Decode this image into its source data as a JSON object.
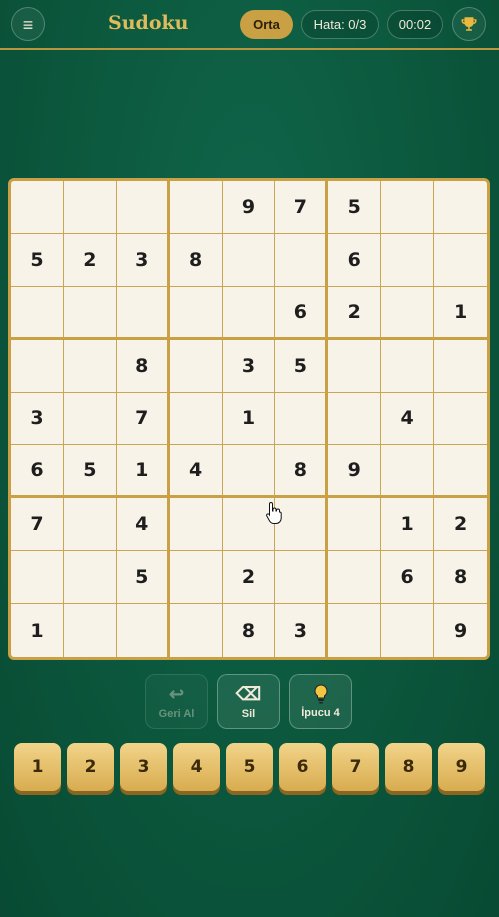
{
  "header": {
    "menu_icon": "≡",
    "title": "Sudoku",
    "difficulty": "Orta",
    "errors": "Hata: 0/3",
    "timer": "00:02",
    "trophy_icon": "trophy-icon"
  },
  "board": {
    "rows": [
      [
        "",
        "",
        "",
        "",
        "9",
        "7",
        "5",
        "",
        ""
      ],
      [
        "5",
        "2",
        "3",
        "8",
        "",
        "",
        "6",
        "",
        ""
      ],
      [
        "",
        "",
        "",
        "",
        "",
        "6",
        "2",
        "",
        "1"
      ],
      [
        "",
        "",
        "8",
        "",
        "3",
        "5",
        "",
        "",
        ""
      ],
      [
        "3",
        "",
        "7",
        "",
        "1",
        "",
        "",
        "4",
        ""
      ],
      [
        "6",
        "5",
        "1",
        "4",
        "",
        "8",
        "9",
        "",
        ""
      ],
      [
        "7",
        "",
        "4",
        "",
        "",
        "",
        "",
        "1",
        "2"
      ],
      [
        "",
        "",
        "5",
        "",
        "2",
        "",
        "",
        "6",
        "8"
      ],
      [
        "1",
        "",
        "",
        "",
        "8",
        "3",
        "",
        "",
        "9"
      ]
    ]
  },
  "tools": {
    "undo_label": "Geri Al",
    "delete_label": "Sil",
    "hint_label": "İpucu 4",
    "undo_icon": "↩",
    "delete_icon": "⌫"
  },
  "numpad": [
    "1",
    "2",
    "3",
    "4",
    "5",
    "6",
    "7",
    "8",
    "9"
  ],
  "colors": {
    "accent": "#c9a043",
    "board_bg": "#f8f3e8",
    "background": "#0c5a3f"
  }
}
